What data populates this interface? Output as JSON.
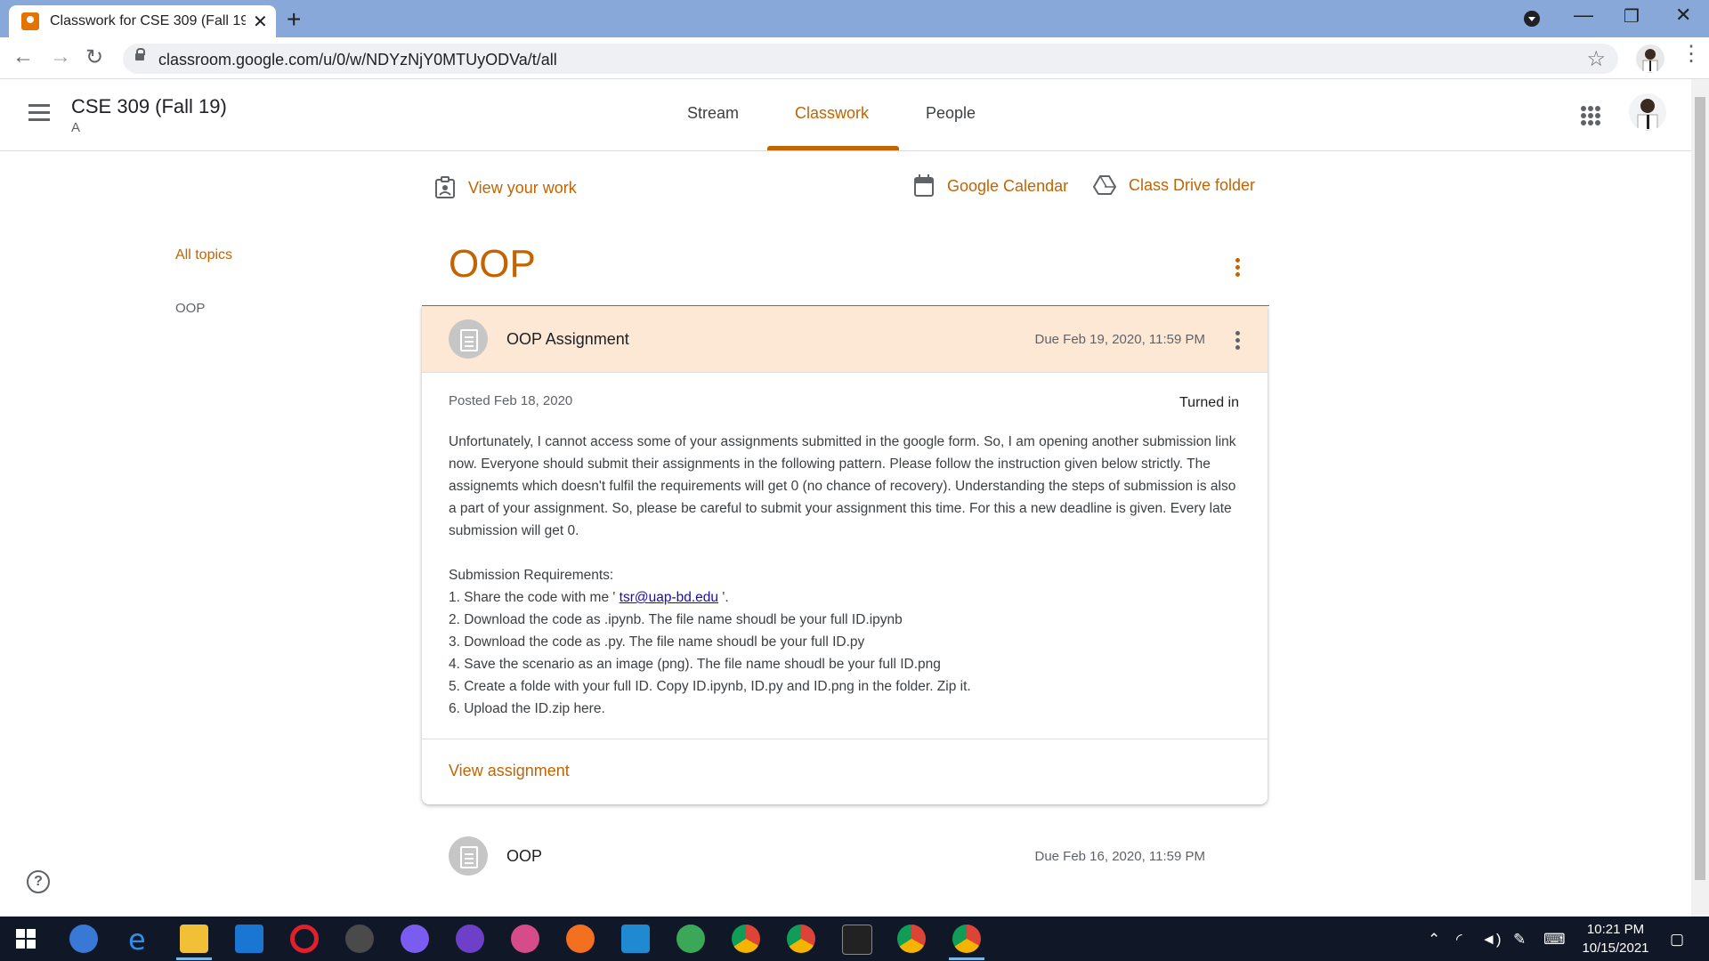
{
  "browser": {
    "tab_title": "Classwork for CSE 309 (Fall 19) A",
    "url": "classroom.google.com/u/0/w/NDYzNjY0MTUyODVa/t/all"
  },
  "header": {
    "class_name": "CSE 309 (Fall 19)",
    "section": "A",
    "tabs": [
      {
        "label": "Stream"
      },
      {
        "label": "Classwork"
      },
      {
        "label": "People"
      }
    ]
  },
  "actions": {
    "view_work": "View your work",
    "calendar": "Google Calendar",
    "drive": "Class Drive folder"
  },
  "sidebar": {
    "all_topics": "All topics",
    "topic": "OOP"
  },
  "topic": {
    "title": "OOP"
  },
  "assignment": {
    "title": "OOP Assignment",
    "due": "Due Feb 19, 2020, 11:59 PM",
    "posted": "Posted Feb 18, 2020",
    "status": "Turned in",
    "description": "Unfortunately, I cannot access some of your assignments submitted in the google form. So, I am opening another submission link now. Everyone should submit their assignments in the following pattern. Please follow the instruction given below strictly. The assignemts which doesn't fulfil the requirements will get 0 (no chance of recovery). Understanding the steps of submission is also a part of your assignment. So, please be careful to submit your assignment this time. For this a new deadline is given. Every late submission will get 0.",
    "requirements_heading": "Submission Requirements:",
    "req1_prefix": "1. Share the code with me ' ",
    "req1_email": "tsr@uap-bd.edu",
    "req1_suffix": " '.",
    "requirements": [
      "2. Download the code as .ipynb. The file name shoudl be your full ID.ipynb",
      "3. Download the code as .py. The file name shoudl be your full ID.py",
      "4. Save the scenario as an image (png). The file name shoudl be your full ID.png",
      "5. Create a folde with your full ID. Copy ID.ipynb, ID.py and ID.png in the folder. Zip it.",
      "6. Upload the ID.zip here."
    ],
    "view_link": "View assignment"
  },
  "assignment2": {
    "title": "OOP",
    "due": "Due Feb 16, 2020, 11:59 PM"
  },
  "taskbar": {
    "time": "10:21 PM",
    "date": "10/15/2021"
  },
  "colors": {
    "accent": "#c26401",
    "card_header": "#fde8d6",
    "tab_bar": "#87a8d9",
    "taskbar": "#101828"
  }
}
